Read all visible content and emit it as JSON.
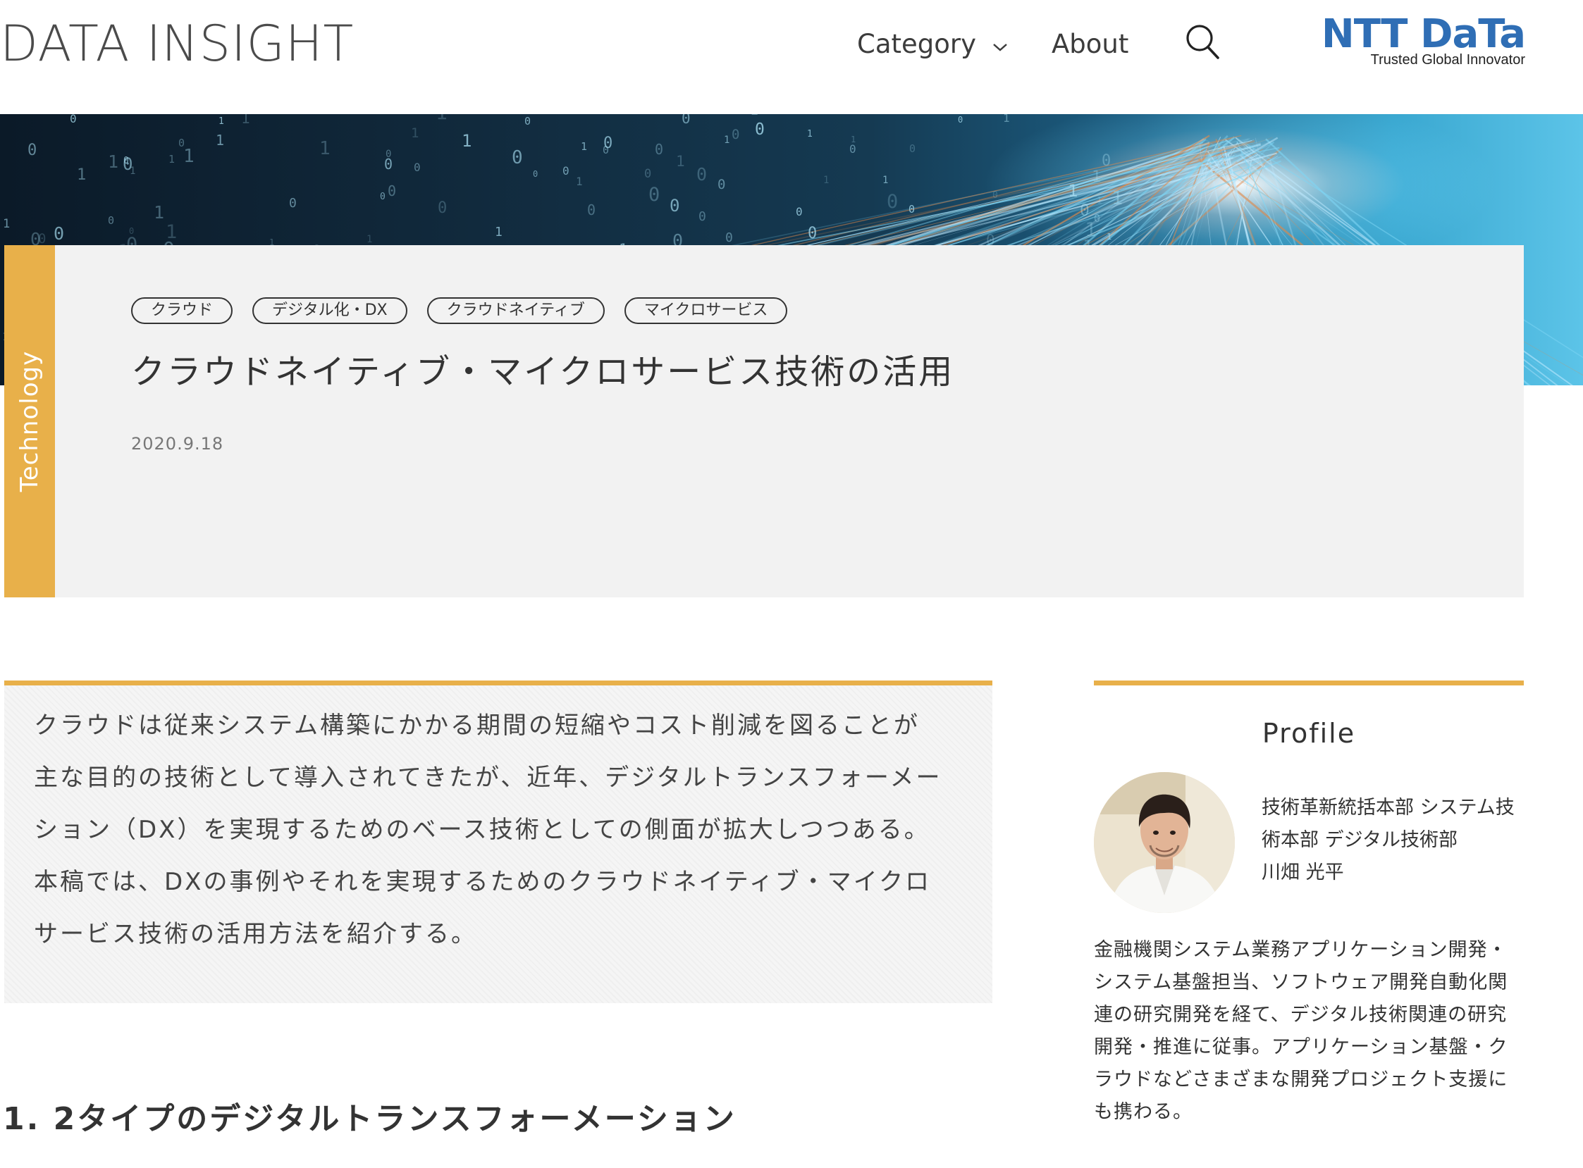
{
  "header": {
    "brand": "DATA INSIGHT",
    "nav": {
      "category": "Category",
      "about": "About"
    },
    "logo": {
      "name": "NTT DaTa",
      "tagline": "Trusted Global Innovator"
    }
  },
  "hero": {
    "image": "binary-data-light-streaks"
  },
  "article": {
    "category": "Technology",
    "tags": [
      "クラウド",
      "デジタル化・DX",
      "クラウドネイティブ",
      "マイクロサービス"
    ],
    "title": "クラウドネイティブ・マイクロサービス技術の活用",
    "date": "2020.9.18",
    "lead_lines": [
      "クラウドは従来システム構築にかかる期間の短縮やコスト削減を図ることが",
      "主な目的の技術として導入されてきたが、近年、デジタルトランスフォーメー",
      "ション（DX）を実現するためのベース技術としての側面が拡大しつつある。",
      "本稿では、DXの事例やそれを実現するためのクラウドネイティブ・マイクロ",
      "サービス技術の活用方法を紹介する。"
    ],
    "section_heading": "1. 2タイプのデジタルトランスフォーメーション"
  },
  "profile": {
    "heading": "Profile",
    "affiliation_lines": [
      "技術革新統括本部 システム技",
      "術本部 デジタル技術部",
      "川畑 光平"
    ],
    "bio_lines": [
      "金融機関システム業務アプリケーション開発・",
      "システム基盤担当、ソフトウェア開発自動化関",
      "連の研究開発を経て、デジタル技術関連の研究",
      "開発・推進に従事。アプリケーション基盤・ク",
      "ラウドなどさまざまな開発プロジェクト支援に",
      "も携わる。"
    ]
  },
  "colors": {
    "accent": "#e8b04a",
    "card_bg": "#f2f2f2",
    "logo_blue": "#2f6eb5"
  }
}
